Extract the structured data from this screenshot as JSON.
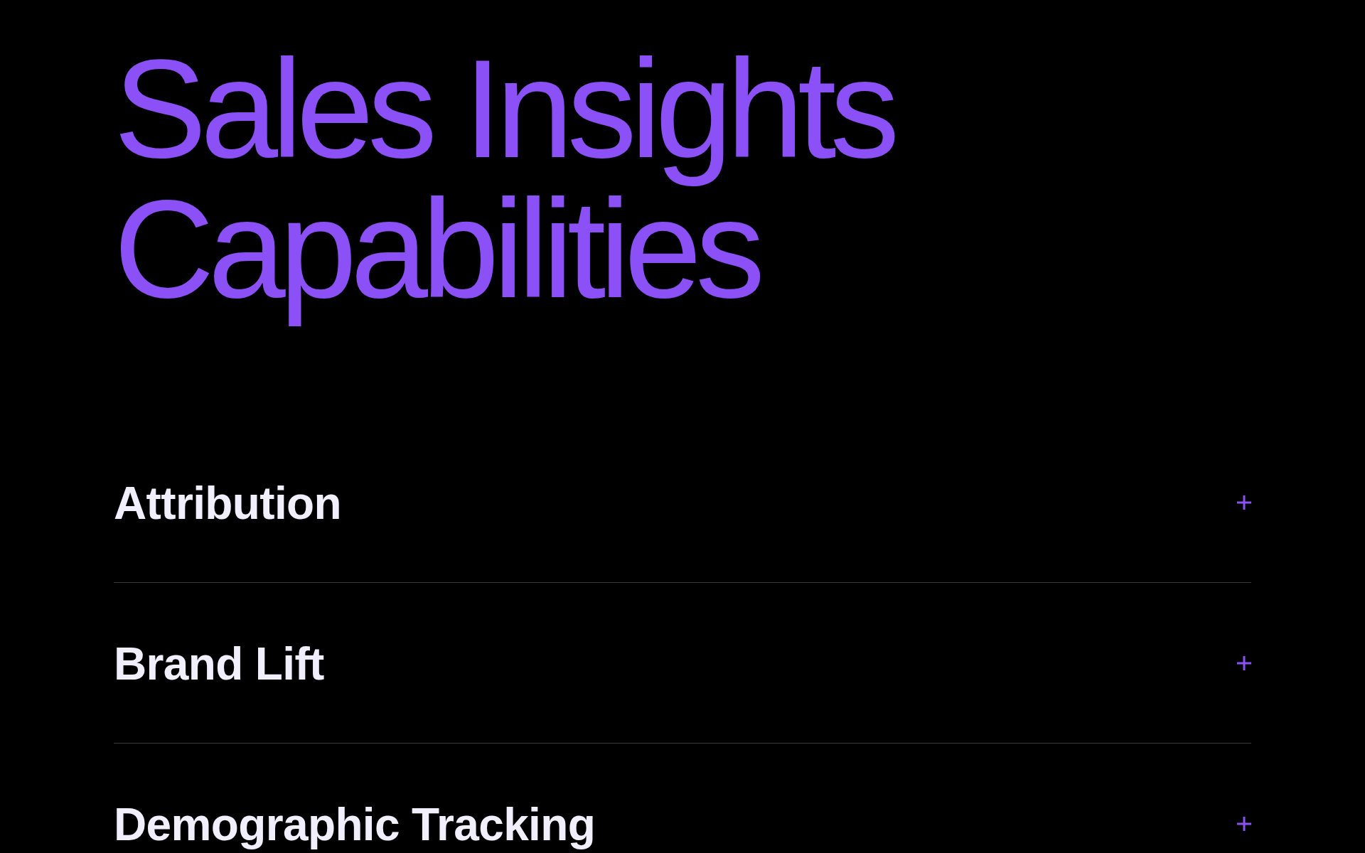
{
  "heading": "Sales Insights Capabilities",
  "capabilities": [
    {
      "label": "Attribution",
      "expanded": false
    },
    {
      "label": "Brand Lift",
      "expanded": false
    },
    {
      "label": "Demographic Tracking",
      "expanded": false
    }
  ]
}
